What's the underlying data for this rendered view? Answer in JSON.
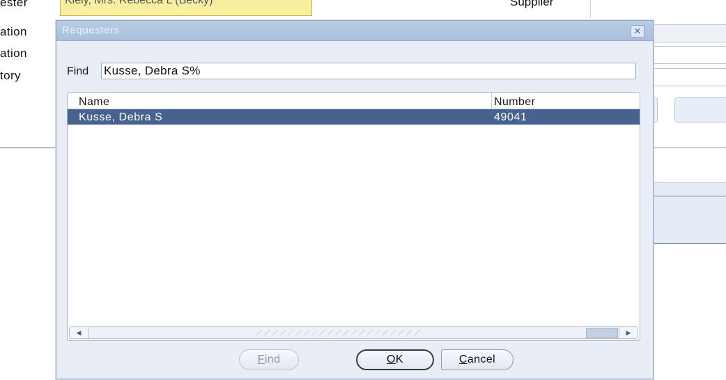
{
  "background": {
    "labels": [
      "ester",
      "ation",
      "ation",
      "tory"
    ],
    "top_field_value": "Kiely, Mrs. Rebecca L (Becky)",
    "supplier_label": "Supplier"
  },
  "dialog": {
    "title": "Requesters",
    "close_icon": "close-icon",
    "find_label": "Find",
    "find_value": "Kusse, Debra S%",
    "columns": {
      "name": "Name",
      "number": "Number"
    },
    "rows": [
      {
        "name": "Kusse, Debra S",
        "number": "49041",
        "selected": true
      }
    ],
    "buttons": {
      "find": {
        "mnemonic": "F",
        "rest": "ind",
        "enabled": false
      },
      "ok": {
        "mnemonic": "O",
        "rest": "K"
      },
      "cancel": {
        "mnemonic": "C",
        "rest": "ancel"
      }
    }
  },
  "colors": {
    "title_bar": "#b0c4df",
    "selected_row": "#46638f",
    "dialog_bg": "#e9eef6"
  }
}
